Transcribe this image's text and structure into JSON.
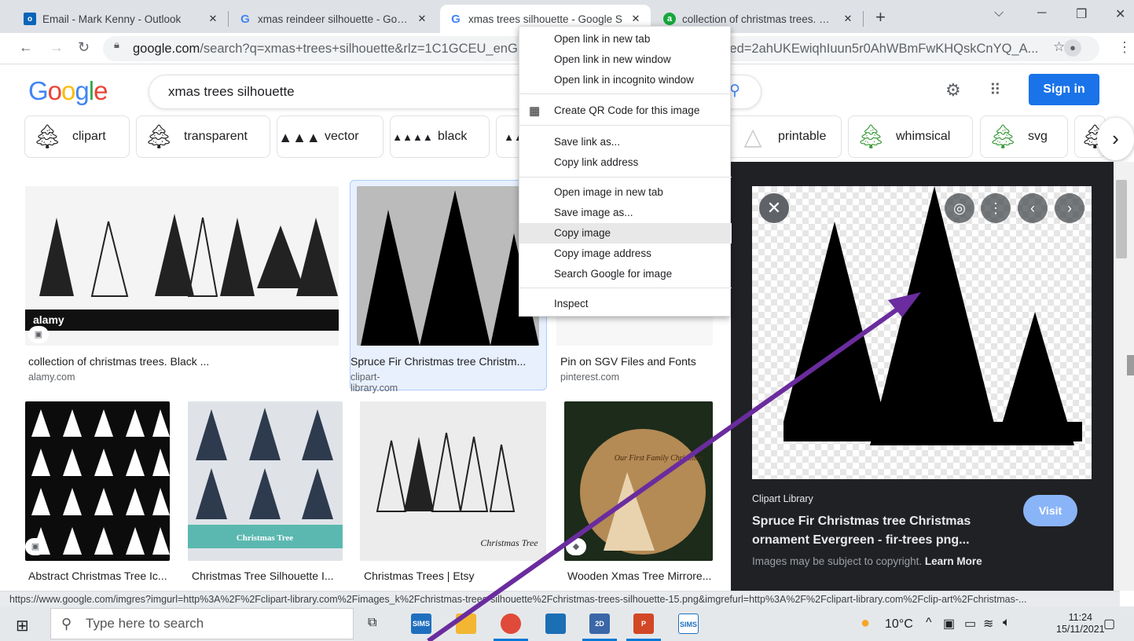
{
  "tabs": [
    {
      "title": "Email - Mark Kenny - Outlook",
      "icon": "outlook-icon"
    },
    {
      "title": "xmas reindeer silhouette - Googl",
      "icon": "google-icon"
    },
    {
      "title": "xmas trees silhouette - Google S",
      "icon": "google-icon"
    },
    {
      "title": "collection of christmas trees. Blac",
      "icon": "alamy-icon"
    }
  ],
  "address": {
    "host": "google.com",
    "path_start": "/search?q=xmas+trees+silhouette&rlz=1C1GCEU_enGB94",
    "path_end": "X&ved=2ahUKEwiqhIuun5r0AhWBmFwKHQskCnYQ_A..."
  },
  "google": {
    "logo": "Google",
    "query": "xmas trees silhouette",
    "sign_in": "Sign in"
  },
  "chips": [
    "clipart",
    "transparent",
    "vector",
    "black",
    "printable",
    "whimsical",
    "svg"
  ],
  "results_row1": [
    {
      "caption": "collection of christmas trees. Black ...",
      "source": "alamy.com",
      "img_text": "alamy"
    },
    {
      "caption": "Spruce Fir Christmas tree Christm...",
      "source": "clipart-library.com"
    },
    {
      "caption": "Pin on SGV Files and Fonts",
      "source": "pinterest.com"
    }
  ],
  "results_row2": [
    {
      "caption": "Abstract Christmas Tree Ic..."
    },
    {
      "caption": "Christmas Tree Silhouette I...",
      "img_text": "Christmas Tree"
    },
    {
      "caption": "Christmas Trees | Etsy",
      "img_text": "Christmas Tree"
    },
    {
      "caption": "Wooden Xmas Tree Mirrore...",
      "img_text": "Our First Family Christmas"
    }
  ],
  "context_menu": [
    "Open link in new tab",
    "Open link in new window",
    "Open link in incognito window",
    "Create QR Code for this image",
    "Save link as...",
    "Copy link address",
    "Open image in new tab",
    "Save image as...",
    "Copy image",
    "Copy image address",
    "Search Google for image",
    "Inspect"
  ],
  "context_menu_highlighted": "Copy image",
  "panel": {
    "source": "Clipart Library",
    "title": "Spruce Fir Christmas tree Christmas ornament Evergreen - fir-trees png...",
    "visit": "Visit",
    "copyright": "Images may be subject to copyright.",
    "learn_more": "Learn More"
  },
  "status_url": "https://www.google.com/imgres?imgurl=http%3A%2F%2Fclipart-library.com%2Fimages_k%2Fchristmas-trees-silhouette%2Fchristmas-trees-silhouette-15.png&imgrefurl=http%3A%2F%2Fclipart-library.com%2Fclip-art%2Fchristmas-...",
  "taskbar": {
    "search_placeholder": "Type here to search",
    "apps": [
      "SIMS",
      "File Explorer",
      "Chrome",
      "SketchUp",
      "2D Design",
      "PowerPoint",
      "SIMS"
    ],
    "weather": "10°C",
    "time": "11:24",
    "date": "15/11/2021"
  },
  "colors": {
    "accent": "#1a73e8",
    "arrow": "#6a2c9e",
    "panel_bg": "#202124"
  }
}
